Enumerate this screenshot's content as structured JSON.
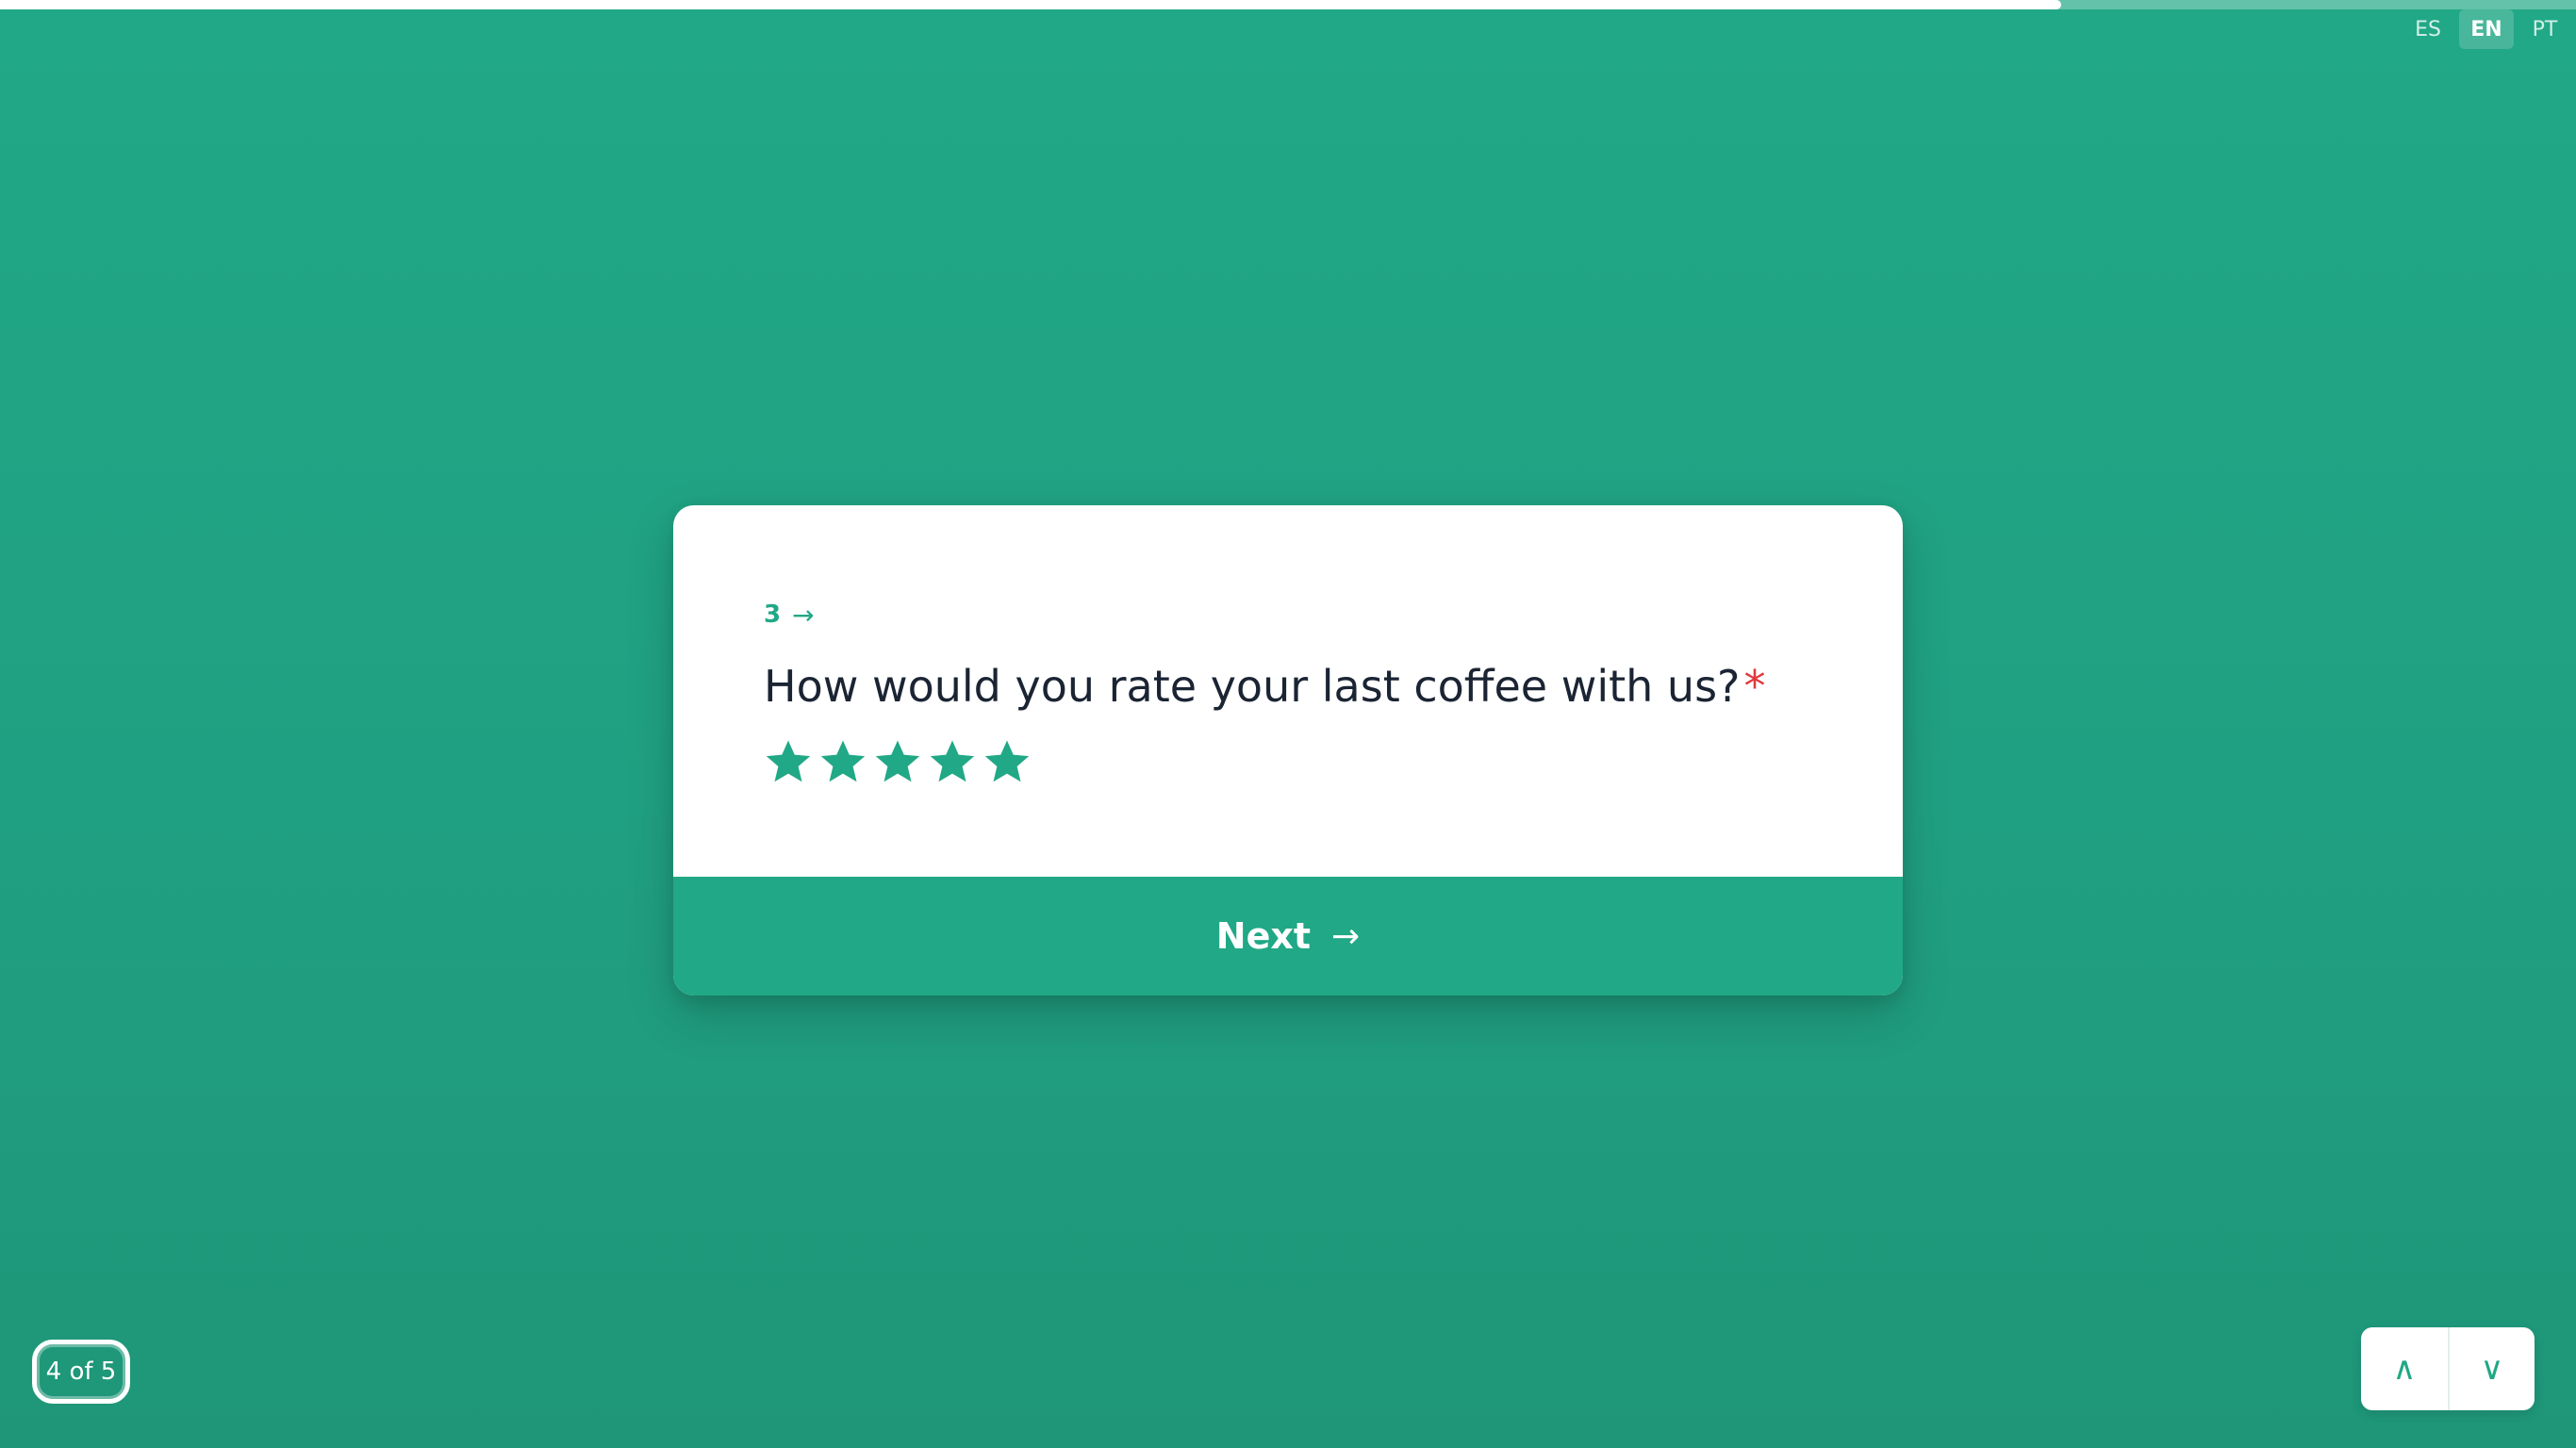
{
  "progress": {
    "fraction": 0.8
  },
  "language": {
    "options": [
      "ES",
      "EN",
      "PT"
    ],
    "active": "EN"
  },
  "question": {
    "number": "3",
    "arrow": "→",
    "title": "How would you rate your last coffee with us?",
    "required_mark": "*",
    "rating": {
      "max": 5,
      "icon": "star-icon",
      "color": "#21a886"
    }
  },
  "next_button": {
    "label": "Next",
    "arrow": "→"
  },
  "step_counter": {
    "label": "4 of 5"
  },
  "nav": {
    "up_label": "∧",
    "down_label": "∨"
  },
  "colors": {
    "brand": "#21a886",
    "text": "#1b2433",
    "required": "#e0383e",
    "card": "#ffffff"
  }
}
